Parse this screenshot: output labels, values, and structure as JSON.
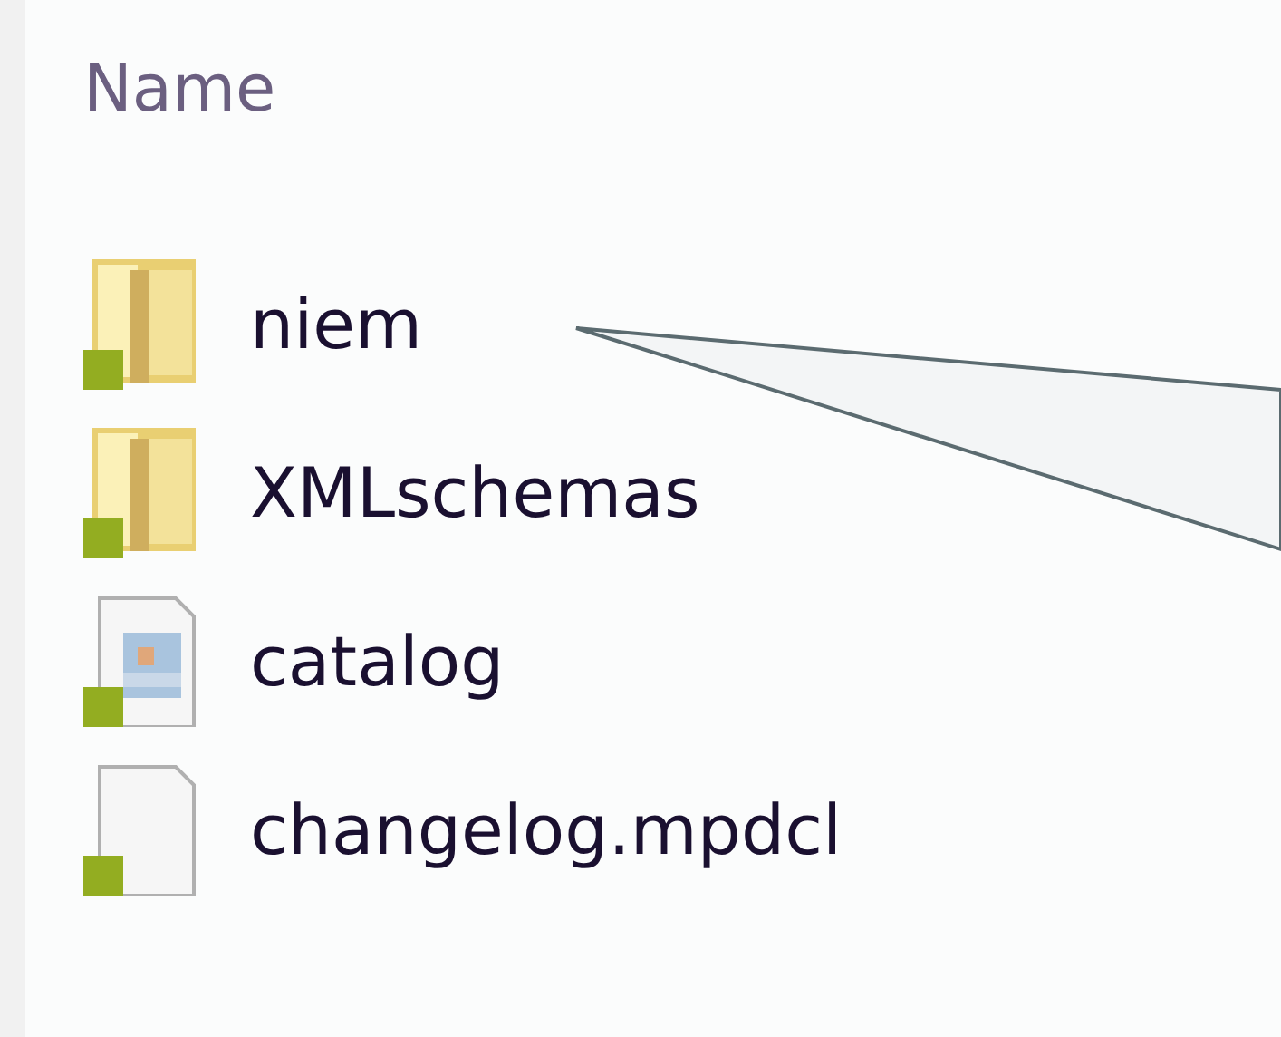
{
  "column_header": "Name",
  "files": [
    {
      "name": "niem",
      "kind": "folder"
    },
    {
      "name": "XMLschemas",
      "kind": "folder"
    },
    {
      "name": "catalog",
      "kind": "image"
    },
    {
      "name": "changelog.mpdcl",
      "kind": "file"
    }
  ]
}
